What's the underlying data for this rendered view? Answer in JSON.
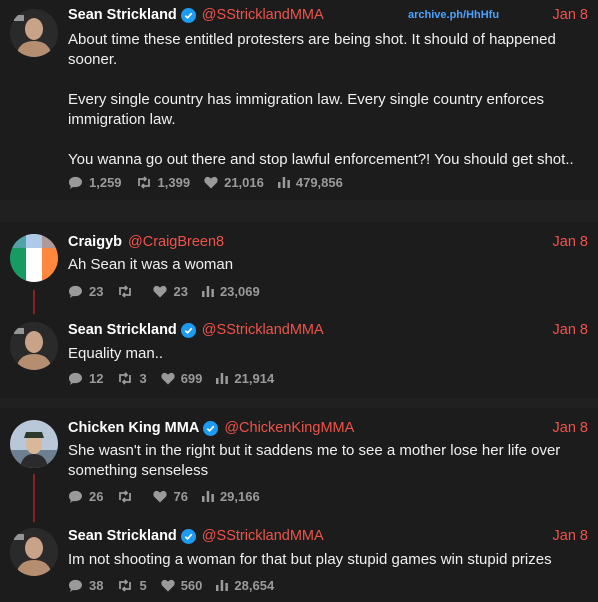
{
  "archive_label": "archive.ph/HhHfu",
  "tweets": [
    {
      "name": "Sean Strickland",
      "verified": true,
      "handle": "@SStricklandMMA",
      "date": "Jan 8",
      "paragraphs": [
        "About time these entitled protesters are being shot. It should of happened sooner.",
        "Every single country has immigration law. Every single country enforces immigration law.",
        "You wanna go out there and stop lawful enforcement?! You should get shot.."
      ],
      "replies": "1,259",
      "retweets": "1,399",
      "likes": "21,016",
      "views": "479,856"
    },
    {
      "name": "Craigyb",
      "verified": false,
      "handle": "@CraigBreen8",
      "date": "Jan 8",
      "paragraphs": [
        "Ah Sean it was a woman"
      ],
      "replies": "23",
      "retweets": "",
      "likes": "23",
      "views": "23,069"
    },
    {
      "name": "Sean Strickland",
      "verified": true,
      "handle": "@SStricklandMMA",
      "date": "Jan 8",
      "paragraphs": [
        "Equality man.."
      ],
      "replies": "12",
      "retweets": "3",
      "likes": "699",
      "views": "21,914"
    },
    {
      "name": "Chicken King MMA",
      "verified": true,
      "handle": "@ChickenKingMMA",
      "date": "Jan 8",
      "paragraphs": [
        "She wasn't in the right but it saddens me to see a mother lose her life over something senseless"
      ],
      "replies": "26",
      "retweets": "",
      "likes": "76",
      "views": "29,166"
    },
    {
      "name": "Sean Strickland",
      "verified": true,
      "handle": "@SStricklandMMA",
      "date": "Jan 8",
      "paragraphs": [
        "Im not shooting a woman for that but play stupid games win stupid prizes"
      ],
      "replies": "38",
      "retweets": "5",
      "likes": "560",
      "views": "28,654"
    }
  ],
  "colors": {
    "background": "#1c1c1c",
    "handle_date": "#f0524a",
    "archive_link": "#4aa3ff",
    "stats": "#9a9a9a",
    "thread_line": "#8a2020",
    "verified": "#1d9bf0"
  }
}
